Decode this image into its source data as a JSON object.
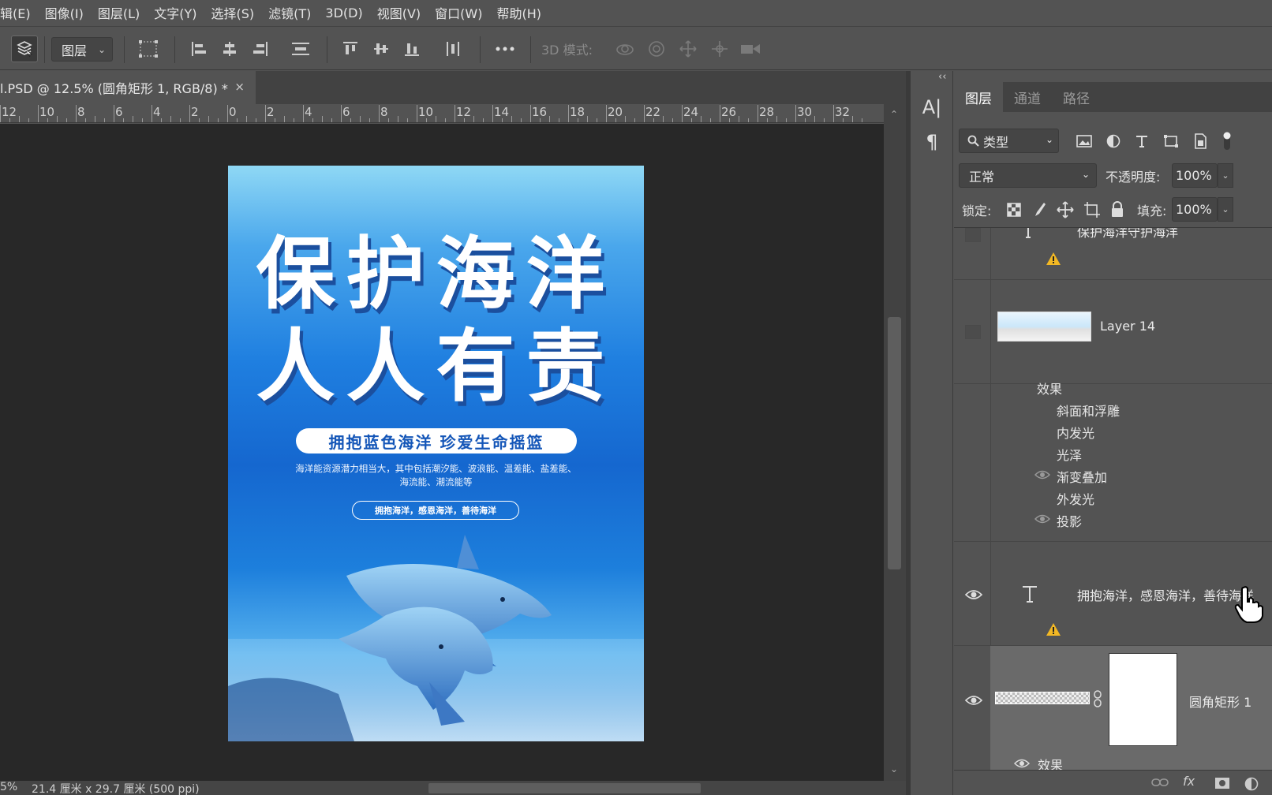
{
  "menu": [
    "辑(E)",
    "图像(I)",
    "图层(L)",
    "文字(Y)",
    "选择(S)",
    "滤镜(T)",
    "3D(D)",
    "视图(V)",
    "窗口(W)",
    "帮助(H)"
  ],
  "options": {
    "layer_select": "图层",
    "mode3d_label": "3D 模式:"
  },
  "document": {
    "tab_title": "l.PSD @ 12.5% (圆角矩形 1, RGB/8) *",
    "close": "×"
  },
  "ruler_labels": [
    "12",
    "10",
    "8",
    "6",
    "4",
    "2",
    "0",
    "2",
    "4",
    "6",
    "8",
    "10",
    "12",
    "14",
    "16",
    "18",
    "20",
    "22",
    "24",
    "26",
    "28",
    "30",
    "32"
  ],
  "poster": {
    "title_line1": "保护海洋",
    "title_line2": "人人有责",
    "pill": "拥抱蓝色海洋  珍爱生命摇篮",
    "desc_line1": "海洋能资源潜力相当大，其中包括潮汐能、波浪能、温差能、盐差能、",
    "desc_line2": "海流能、潮流能等",
    "slogan": "拥抱海洋，感恩海洋，善待海洋"
  },
  "status": {
    "zoom": "5%",
    "doc_size": "21.4 厘米 x 29.7 厘米 (500 ppi)"
  },
  "sidestrip": {
    "collapse": "‹‹",
    "char_icon": "A|",
    "para_icon": "¶"
  },
  "layers_panel": {
    "tabs": [
      "图层",
      "通道",
      "路径"
    ],
    "filter_label": "类型",
    "blend_mode": "正常",
    "opacity_label": "不透明度:",
    "opacity_value": "100%",
    "lock_label": "锁定:",
    "fill_label": "填充:",
    "fill_value": "100%",
    "layers": {
      "text_top_name": "保护海洋守护海洋",
      "layer14_name": "Layer 14",
      "effects_label": "效果",
      "effects": [
        "斜面和浮雕",
        "内发光",
        "光泽",
        "渐变叠加",
        "外发光",
        "投影"
      ],
      "text2_name": "拥抱海洋，感恩海洋，善待海洋",
      "shape_name": "圆角矩形 1",
      "shape_effects_label": "效果"
    },
    "bottom_icons": [
      "link-icon",
      "fx-icon",
      "mask-icon",
      "adjustment-icon"
    ],
    "bottom_fx": "fx"
  }
}
